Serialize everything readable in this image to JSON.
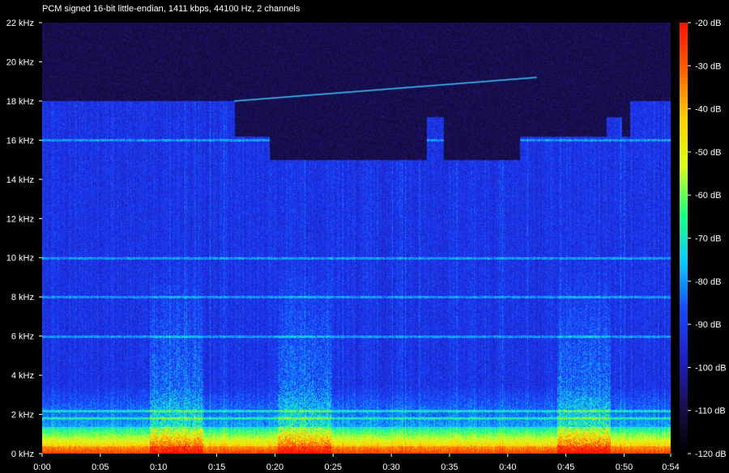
{
  "header": {
    "format_info": "PCM signed 16-bit little-endian, 1411 kbps, 44100 Hz, 2 channels"
  },
  "chart_data": {
    "type": "heatmap",
    "title": "PCM signed 16-bit little-endian, 1411 kbps, 44100 Hz, 2 channels",
    "x_axis": {
      "ticks": [
        "0:00",
        "0:05",
        "0:10",
        "0:15",
        "0:20",
        "0:25",
        "0:30",
        "0:35",
        "0:40",
        "0:45",
        "0:50",
        "0:54"
      ],
      "tick_seconds": [
        0,
        5,
        10,
        15,
        20,
        25,
        30,
        35,
        40,
        45,
        50,
        54
      ],
      "range_seconds": [
        0,
        54
      ]
    },
    "y_axis": {
      "ticks": [
        "0 kHz",
        "2 kHz",
        "4 kHz",
        "6 kHz",
        "8 kHz",
        "10 kHz",
        "12 kHz",
        "14 kHz",
        "16 kHz",
        "18 kHz",
        "20 kHz",
        "22 kHz"
      ],
      "tick_khz": [
        0,
        2,
        4,
        6,
        8,
        10,
        12,
        14,
        16,
        18,
        20,
        22
      ],
      "range_khz": [
        0,
        22
      ]
    },
    "colorbar": {
      "ticks": [
        "-20 dB",
        "-30 dB",
        "-40 dB",
        "-50 dB",
        "-60 dB",
        "-70 dB",
        "-80 dB",
        "-90 dB",
        "-100 dB",
        "-110 dB",
        "-120 dB"
      ],
      "tick_db": [
        -20,
        -30,
        -40,
        -50,
        -60,
        -70,
        -80,
        -90,
        -100,
        -110,
        -120
      ],
      "range_db": [
        -120,
        -20
      ],
      "placement": "right",
      "colors": [
        "#000000",
        "#1a0f50",
        "#2020c8",
        "#1848ff",
        "#10c8ff",
        "#20ff80",
        "#d8ff20",
        "#ffd000",
        "#ff6000",
        "#ff1000"
      ]
    },
    "content_cutoff_khz": 18,
    "cutoff_gap": {
      "time_range_seconds": [
        16.5,
        50.5
      ],
      "lowered_cutoff_khz": 15
    },
    "tone_sweep": {
      "start": [
        16.5,
        18.0
      ],
      "end": [
        42.5,
        19.2
      ],
      "unit": "seconds, kHz"
    },
    "loud_sections_seconds": [
      [
        10,
        13
      ],
      [
        21,
        24
      ],
      [
        45,
        48
      ]
    ],
    "horizontal_lines_khz": [
      1.8,
      2.2,
      6.0,
      8.0,
      10.0,
      16.0
    ]
  }
}
